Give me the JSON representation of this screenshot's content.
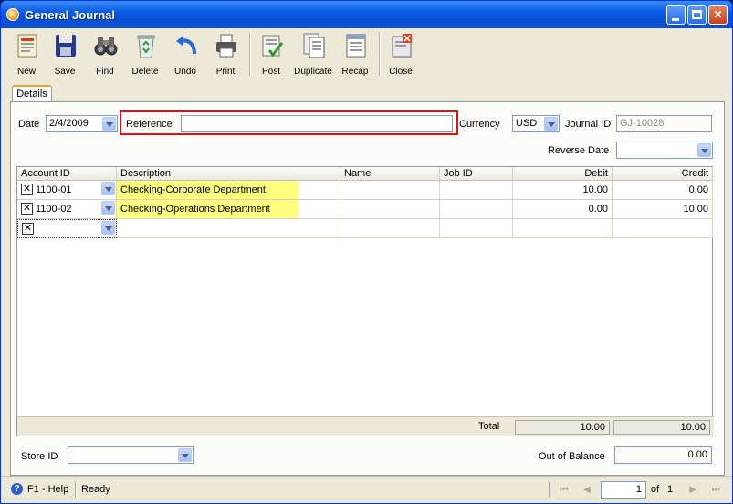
{
  "window": {
    "title": "General Journal"
  },
  "toolbar": [
    {
      "label": "New",
      "icon": "new-document-icon"
    },
    {
      "label": "Save",
      "icon": "floppy-disk-icon"
    },
    {
      "label": "Find",
      "icon": "binoculars-icon"
    },
    {
      "label": "Delete",
      "icon": "recycle-bin-icon"
    },
    {
      "label": "Undo",
      "icon": "undo-arrow-icon"
    },
    {
      "label": "Print",
      "icon": "printer-icon"
    },
    {
      "label": "Post",
      "icon": "post-check-icon"
    },
    {
      "label": "Duplicate",
      "icon": "duplicate-icon"
    },
    {
      "label": "Recap",
      "icon": "recap-icon"
    },
    {
      "label": "Close",
      "icon": "close-form-icon"
    }
  ],
  "tabs": {
    "details": "Details"
  },
  "form": {
    "date_label": "Date",
    "date_value": "2/4/2009",
    "reference_label": "Reference",
    "reference_value": "",
    "currency_label": "Currency",
    "currency_value": "USD",
    "journal_id_label": "Journal ID",
    "journal_id_value": "GJ-10028",
    "reverse_date_label": "Reverse Date",
    "reverse_date_value": ""
  },
  "grid": {
    "columns": [
      "Account ID",
      "Description",
      "Name",
      "Job ID",
      "Debit",
      "Credit"
    ],
    "rows": [
      {
        "account": "1100-01",
        "description": "Checking-Corporate Department",
        "name": "",
        "job": "",
        "debit": "10.00",
        "credit": "0.00"
      },
      {
        "account": "1100-02",
        "description": "Checking-Operations Department",
        "name": "",
        "job": "",
        "debit": "0.00",
        "credit": "10.00"
      },
      {
        "account": "",
        "description": "",
        "name": "",
        "job": "",
        "debit": "",
        "credit": ""
      }
    ],
    "total_label": "Total",
    "total_debit": "10.00",
    "total_credit": "10.00"
  },
  "footer": {
    "store_label": "Store ID",
    "store_value": "",
    "out_of_balance_label": "Out of Balance",
    "out_of_balance_value": "0.00"
  },
  "status": {
    "help": "F1 - Help",
    "state": "Ready",
    "page": "1",
    "of_label": "of",
    "total_pages": "1"
  },
  "colors": {
    "highlight": "#ffff80",
    "reference_outline": "#e01010"
  }
}
